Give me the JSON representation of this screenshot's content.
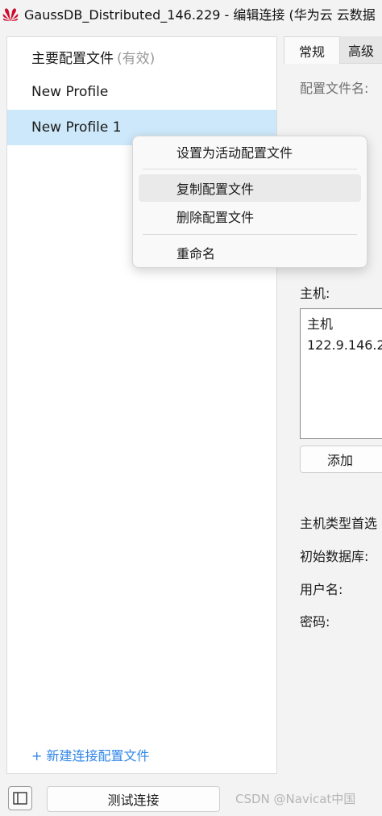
{
  "window": {
    "title": "GaussDB_Distributed_146.229 - 编辑连接 (华为云 云数据",
    "logo_icon": "huawei-logo",
    "brand_color": "#cf0a2c"
  },
  "profiles": {
    "items": [
      {
        "label": "主要配置文件",
        "note": "(有效)"
      },
      {
        "label": "New Profile"
      },
      {
        "label": "New Profile 1",
        "selected": true
      }
    ],
    "new_profile_link": "+ 新建连接配置文件"
  },
  "context_menu": {
    "items": [
      {
        "label": "设置为活动配置文件"
      },
      {
        "label": "复制配置文件",
        "hover": true
      },
      {
        "label": "删除配置文件"
      },
      {
        "label": "重命名"
      }
    ]
  },
  "tabs": [
    {
      "label": "常规",
      "active": true
    },
    {
      "label": "高级",
      "active": false
    }
  ],
  "general": {
    "profile_name_label": "配置文件名:",
    "host_label": "主机:",
    "host_list": {
      "header": "主机",
      "items": [
        "122.9.146.2"
      ]
    },
    "add_button": "添加",
    "host_type_label": "主机类型首选",
    "initial_db_label": "初始数据库:",
    "username_label": "用户名:",
    "password_label": "密码:"
  },
  "bottom": {
    "toggle_icon": "sidebar-toggle-icon",
    "test_button": "测试连接",
    "watermark": "CSDN @Navicat中国"
  },
  "colors": {
    "selection": "#cce8fa",
    "link": "#2f86e8"
  }
}
